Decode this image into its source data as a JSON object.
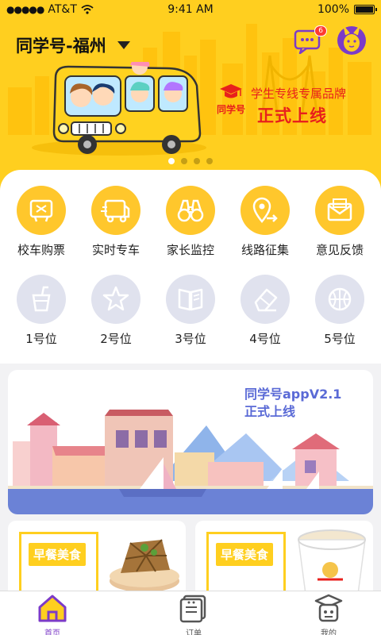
{
  "status_bar": {
    "carrier": "AT&T",
    "time": "9:41 AM",
    "battery_percent": "100%",
    "battery_level": 1.0
  },
  "header": {
    "city": "同学号-福州",
    "message_badge": "6",
    "icons": [
      "message-icon",
      "avatar-icon",
      "dropdown-caret-icon"
    ]
  },
  "banner": {
    "slogan": "学生专线专属品牌",
    "launch_text": "正式上线",
    "brand_name": "同学号",
    "slide_count": 4,
    "active_slide": 1
  },
  "services": [
    {
      "label": "校车购票",
      "icon": "ticket-icon"
    },
    {
      "label": "实时专车",
      "icon": "bus-icon"
    },
    {
      "label": "家长监控",
      "icon": "binoculars-icon"
    },
    {
      "label": "线路征集",
      "icon": "route-pin-icon"
    },
    {
      "label": "意见反馈",
      "icon": "envelope-icon"
    }
  ],
  "slots": [
    {
      "label": "1号位",
      "icon": "cup-icon"
    },
    {
      "label": "2号位",
      "icon": "star-icon"
    },
    {
      "label": "3号位",
      "icon": "book-icon"
    },
    {
      "label": "4号位",
      "icon": "eraser-icon"
    },
    {
      "label": "5号位",
      "icon": "ball-icon"
    }
  ],
  "promo": {
    "line1": "同学号appV2.1",
    "line2": "正式上线"
  },
  "food_cards": [
    {
      "tag": "早餐美食",
      "icon": "tofu-dish-icon"
    },
    {
      "tag": "早餐美食",
      "icon": "soy-milk-cup-icon"
    }
  ],
  "tabbar": [
    {
      "label": "首页",
      "icon": "home-icon",
      "active": true
    },
    {
      "label": "订单",
      "icon": "order-icon",
      "active": false
    },
    {
      "label": "我的",
      "icon": "profile-icon",
      "active": false
    }
  ],
  "colors": {
    "brand_yellow": "#ffcf1f",
    "accent_red": "#e8201c",
    "accent_purple": "#7c3bc8",
    "promo_blue": "#5a6ad6",
    "slot_grey": "#e0e2ee"
  }
}
